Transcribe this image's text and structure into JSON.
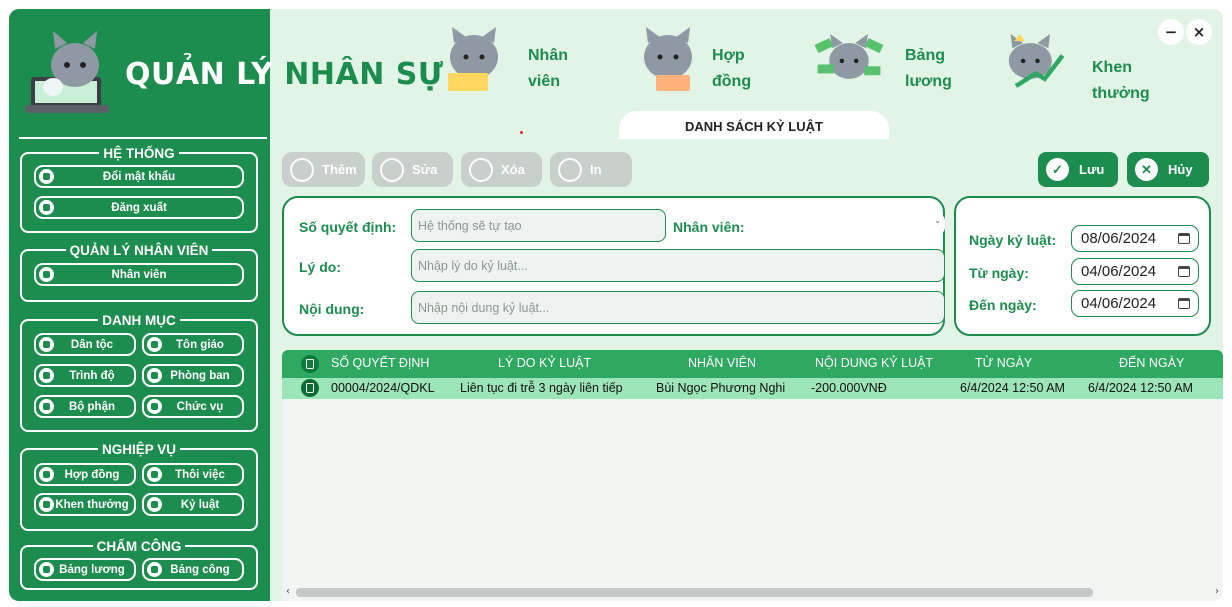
{
  "app": {
    "title_part1": "QUẢN LÝ",
    "title_part2": "NHÂN SỰ"
  },
  "nav_tabs": [
    {
      "label": "Nhân\nviên",
      "icon": "cat-laptop-icon"
    },
    {
      "label": "Hợp\nđồng",
      "icon": "cat-contract-icon"
    },
    {
      "label": "Bảng\nlương",
      "icon": "cat-money-icon"
    },
    {
      "label": "Khen\nthưởng",
      "icon": "cat-reward-icon"
    }
  ],
  "window_controls": {
    "minimize": "−",
    "close": "×"
  },
  "active_tab": "DANH SÁCH KỶ LUẬT",
  "sidebar": {
    "he_thong": {
      "title": "HỆ THỐNG",
      "items": [
        "Đổi mật khẩu",
        "Đăng xuất"
      ]
    },
    "quan_ly_nhan_vien": {
      "title": "QUẢN LÝ NHÂN VIÊN",
      "items": [
        "Nhân viên"
      ]
    },
    "danh_muc": {
      "title": "DANH MỤC",
      "items": [
        "Dân tộc",
        "Tôn giáo",
        "Trình độ",
        "Phòng ban",
        "Bộ phận",
        "Chức vụ"
      ]
    },
    "nghiep_vu": {
      "title": "NGHIỆP VỤ",
      "items": [
        "Hợp đồng",
        "Thôi việc",
        "Khen thưởng",
        "Kỷ luật"
      ]
    },
    "cham_cong": {
      "title": "CHẤM CÔNG",
      "items": [
        "Bảng lương",
        "Bảng công"
      ]
    }
  },
  "toolbar": {
    "add": "Thêm",
    "edit": "Sửa",
    "delete": "Xóa",
    "print": "In",
    "save": "Lưu",
    "cancel": "Hủy"
  },
  "form": {
    "so_quyet_dinh_label": "Số quyết định:",
    "so_quyet_dinh_value": "Hệ thống sẽ tự tạo",
    "nhan_vien_label": "Nhân viên:",
    "nhan_vien_value": "",
    "ly_do_label": "Lý do:",
    "ly_do_placeholder": "Nhập lý do kỷ luật...",
    "noi_dung_label": "Nội dung:",
    "noi_dung_placeholder": "Nhập nội dung kỷ luật...",
    "ngay_ky_luat_label": "Ngày kỷ luật:",
    "ngay_ky_luat_value": "08/06/2024",
    "tu_ngay_label": "Từ ngày:",
    "tu_ngay_value": "04/06/2024",
    "den_ngay_label": "Đến ngày:",
    "den_ngay_value": "04/06/2024"
  },
  "table": {
    "columns": [
      "SỐ QUYẾT ĐỊNH",
      "LÝ DO KỶ LUẬT",
      "NHÂN VIÊN",
      "NỘI DUNG KỶ LUẬT",
      "TỪ NGÀY",
      "ĐẾN NGÀY"
    ],
    "rows": [
      [
        "00004/2024/QDKL",
        "Liên tục đi trễ 3 ngày liên tiếp",
        "Bùi Ngọc Phương Nghi",
        "-200.000VNĐ",
        "6/4/2024 12:50 AM",
        "6/4/2024 12:50 AM"
      ]
    ]
  },
  "colors": {
    "primary": "#1d8c4f",
    "header_bg": "#e2f4e6",
    "table_header": "#2fa862",
    "selected_row": "#9ce5b8"
  }
}
